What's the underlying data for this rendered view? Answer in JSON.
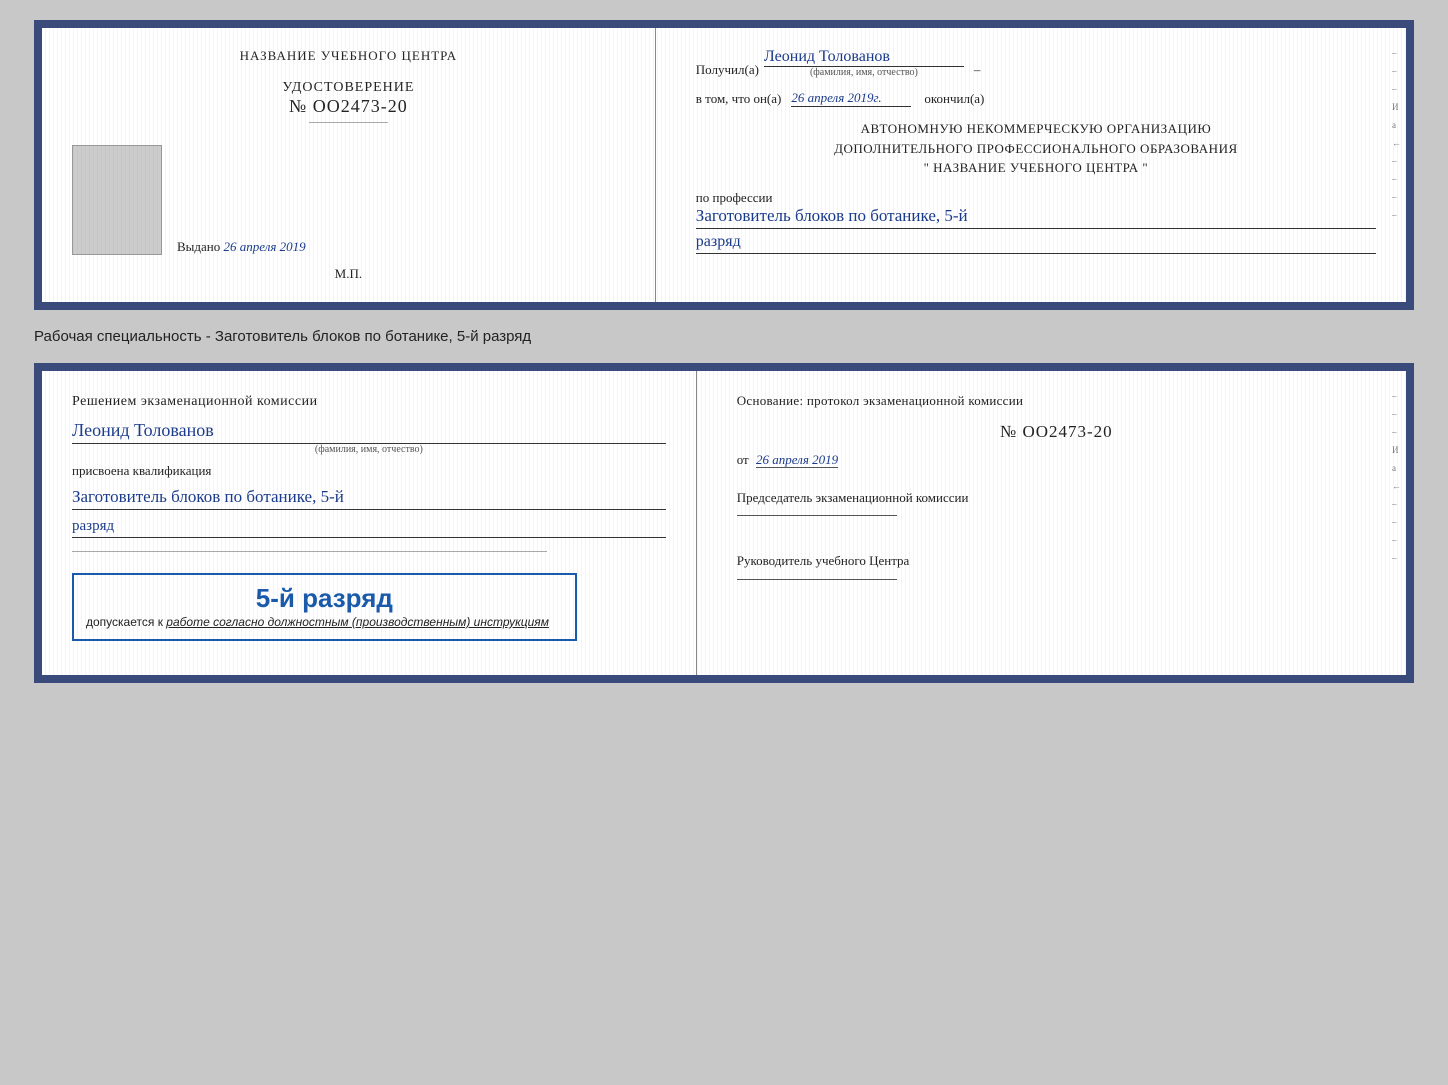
{
  "page": {
    "background": "#c8c8c8"
  },
  "top_doc": {
    "left": {
      "center_title": "НАЗВАНИЕ УЧЕБНОГО ЦЕНТРА",
      "udostoverenie_label": "УДОСТОВЕРЕНИЕ",
      "number": "№ OO2473-20",
      "vydano_label": "Выдано",
      "vydano_date": "26 апреля 2019",
      "mp_label": "М.П."
    },
    "right": {
      "poluchil_label": "Получил(а)",
      "person_name": "Леонид Толованов",
      "fio_caption": "(фамилия, имя, отчество)",
      "vtom_label": "в том, что он(а)",
      "vtom_date": "26 апреля 2019г.",
      "okonchil_label": "окончил(а)",
      "org_line1": "АВТОНОМНУЮ НЕКОММЕРЧЕСКУЮ ОРГАНИЗАЦИЮ",
      "org_line2": "ДОПОЛНИТЕЛЬНОГО ПРОФЕССИОНАЛЬНОГО ОБРАЗОВАНИЯ",
      "org_line3": "\"   НАЗВАНИЕ УЧЕБНОГО ЦЕНТРА   \"",
      "po_professii_label": "по профессии",
      "profession": "Заготовитель блоков по ботанике, 5-й",
      "razryad": "разряд"
    }
  },
  "middle": {
    "text": "Рабочая специальность - Заготовитель блоков по ботанике, 5-й разряд"
  },
  "bottom_doc": {
    "left": {
      "resheniyem_label": "Решением экзаменационной комиссии",
      "person_name": "Леонид Толованов",
      "fio_caption": "(фамилия, имя, отчество)",
      "prisvoena_label": "присвоена квалификация",
      "kvali_text": "Заготовитель блоков по ботанике, 5-й",
      "razryad": "разряд",
      "box_number": "5-й разряд",
      "dopuskaetsya_label": "допускается к",
      "dopuskaetsya_text": "работе согласно должностным (производственным) инструкциям"
    },
    "right": {
      "osnov_label": "Основание: протокол экзаменационной комиссии",
      "protocol_number": "№  OO2473-20",
      "ot_label": "от",
      "ot_date": "26 апреля 2019",
      "predsedatel_label": "Председатель экзаменационной комиссии",
      "rukovoditel_label": "Руководитель учебного Центра"
    }
  },
  "side_marks": [
    "–",
    "–",
    "–",
    "И",
    "а",
    "←",
    "–",
    "–",
    "–",
    "–"
  ]
}
